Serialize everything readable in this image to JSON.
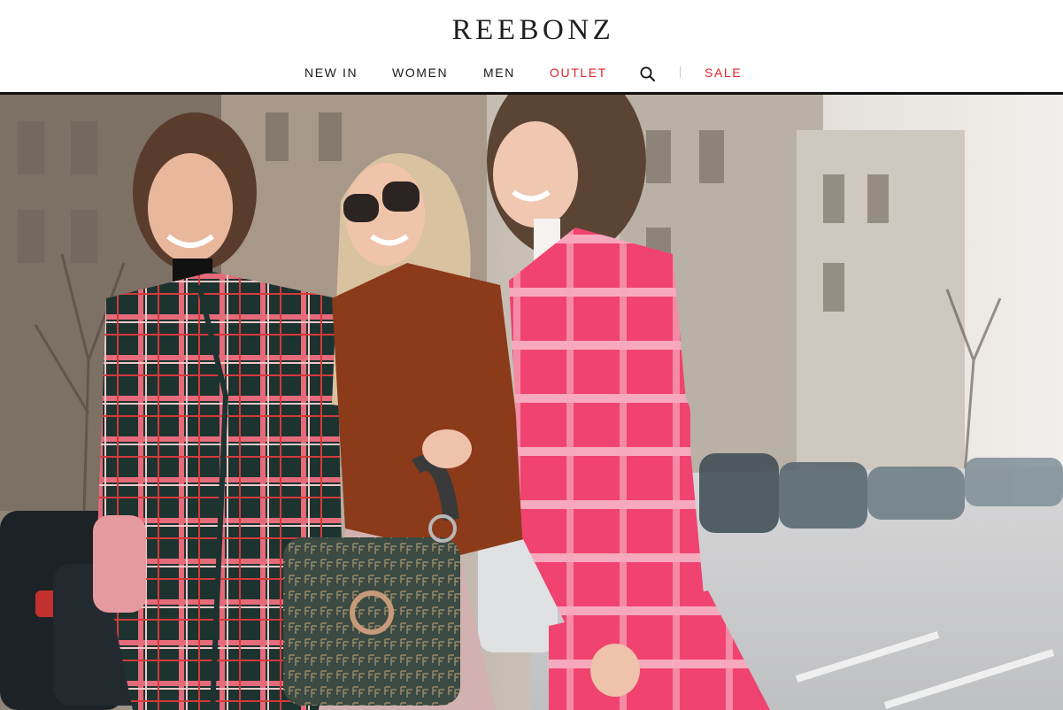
{
  "header": {
    "logo_text": "REEBONZ"
  },
  "nav": {
    "items": [
      {
        "label": "NEW IN"
      },
      {
        "label": "WOMEN"
      },
      {
        "label": "MEN"
      },
      {
        "label": "OUTLET"
      },
      {
        "label": "SALE"
      }
    ],
    "search_icon": "search-icon",
    "accent_color": "#e2232a"
  },
  "hero": {
    "image": "street-style-photo-three-women"
  }
}
